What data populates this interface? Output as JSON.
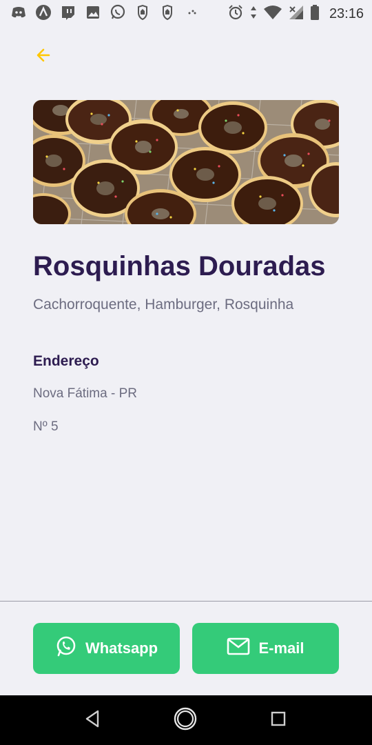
{
  "status_bar": {
    "time": "23:16",
    "left_icons": [
      "discord-icon",
      "app-icon",
      "twitch-icon",
      "image-icon",
      "whatsapp-icon",
      "hand-icon",
      "hand-icon",
      "more-dots-icon"
    ],
    "right_icons": [
      "alarm-icon",
      "data-arrows-icon",
      "wifi-icon",
      "signal-icon",
      "battery-icon"
    ]
  },
  "header": {
    "back_icon": "arrow-left-icon",
    "accent_color": "#FFC700"
  },
  "point": {
    "image_alt": "Chocolate glazed donuts with sprinkles",
    "name": "Rosquinhas Douradas",
    "items": "Cachorroquente, Hamburger, Rosquinha"
  },
  "address": {
    "title": "Endereço",
    "city_uf": "Nova Fátima - PR",
    "number": "Nº 5"
  },
  "footer": {
    "whatsapp_label": "Whatsapp",
    "email_label": "E-mail",
    "button_color": "#34CB79"
  },
  "nav": {
    "back": "nav-back-icon",
    "home": "nav-home-icon",
    "recents": "nav-recents-icon"
  }
}
